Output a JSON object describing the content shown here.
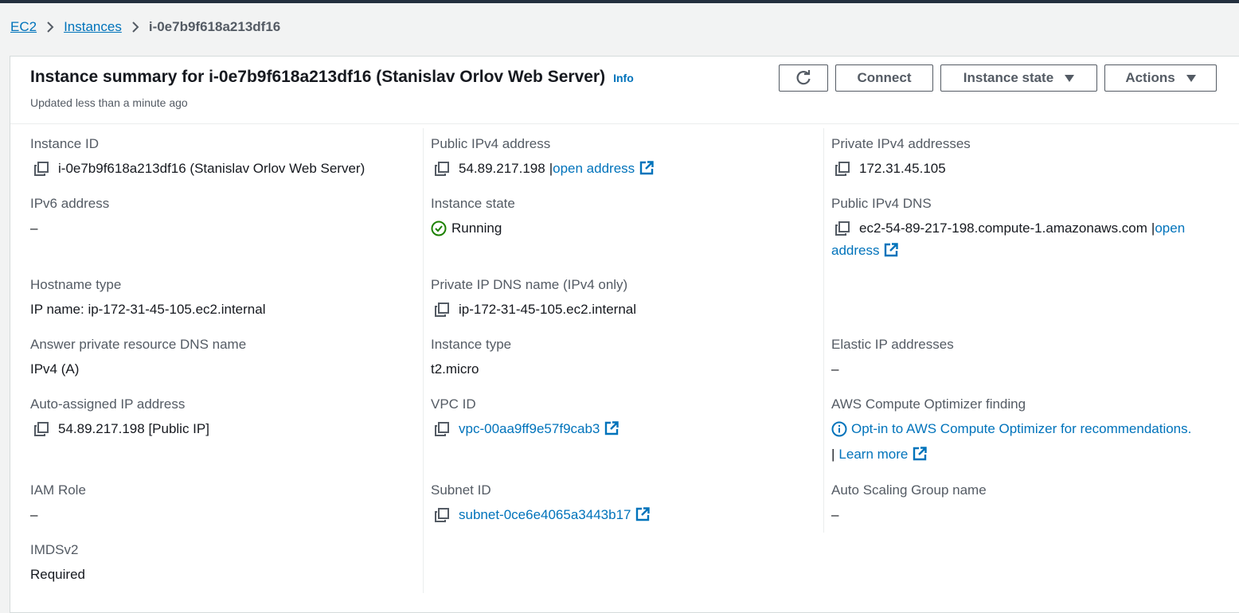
{
  "breadcrumb": {
    "root": "EC2",
    "parent": "Instances",
    "current": "i-0e7b9f618a213df16"
  },
  "header": {
    "title": "Instance summary for i-0e7b9f618a213df16 (Stanislav Orlov Web Server)",
    "info": "Info",
    "subtitle": "Updated less than a minute ago",
    "connect": "Connect",
    "instance_state": "Instance state",
    "actions": "Actions"
  },
  "fields": {
    "instance_id": {
      "label": "Instance ID",
      "value": "i-0e7b9f618a213df16 (Stanislav Orlov Web Server)"
    },
    "public_ipv4": {
      "label": "Public IPv4 address",
      "value": "54.89.217.198",
      "sep": "|",
      "link": "open address"
    },
    "private_ipv4": {
      "label": "Private IPv4 addresses",
      "value": "172.31.45.105"
    },
    "ipv6": {
      "label": "IPv6 address",
      "value": "–"
    },
    "instance_state": {
      "label": "Instance state",
      "value": "Running"
    },
    "public_dns": {
      "label": "Public IPv4 DNS",
      "value": "ec2-54-89-217-198.compute-1.amazonaws.com",
      "sep": "|",
      "link_part1": "open",
      "link_part2": "address"
    },
    "hostname_type": {
      "label": "Hostname type",
      "value": "IP name: ip-172-31-45-105.ec2.internal"
    },
    "private_dns": {
      "label": "Private IP DNS name (IPv4 only)",
      "value": "ip-172-31-45-105.ec2.internal"
    },
    "answer_dns": {
      "label": "Answer private resource DNS name",
      "value": "IPv4 (A)"
    },
    "instance_type": {
      "label": "Instance type",
      "value": "t2.micro"
    },
    "elastic_ip": {
      "label": "Elastic IP addresses",
      "value": "–"
    },
    "auto_ip": {
      "label": "Auto-assigned IP address",
      "value": "54.89.217.198 [Public IP]"
    },
    "vpc_id": {
      "label": "VPC ID",
      "value": "vpc-00aa9ff9e57f9cab3"
    },
    "optimizer": {
      "label": "AWS Compute Optimizer finding",
      "link": "Opt-in to AWS Compute Optimizer for recommendations.",
      "sep": "|",
      "learn_more": "Learn more"
    },
    "iam_role": {
      "label": "IAM Role",
      "value": "–"
    },
    "subnet_id": {
      "label": "Subnet ID",
      "value": "subnet-0ce6e4065a3443b17"
    },
    "asg_name": {
      "label": "Auto Scaling Group name",
      "value": "–"
    },
    "imdsv2": {
      "label": "IMDSv2",
      "value": "Required"
    }
  },
  "colors": {
    "link": "#0073bb",
    "success": "#1d8102",
    "text": "#16191f",
    "label": "#545b64"
  }
}
